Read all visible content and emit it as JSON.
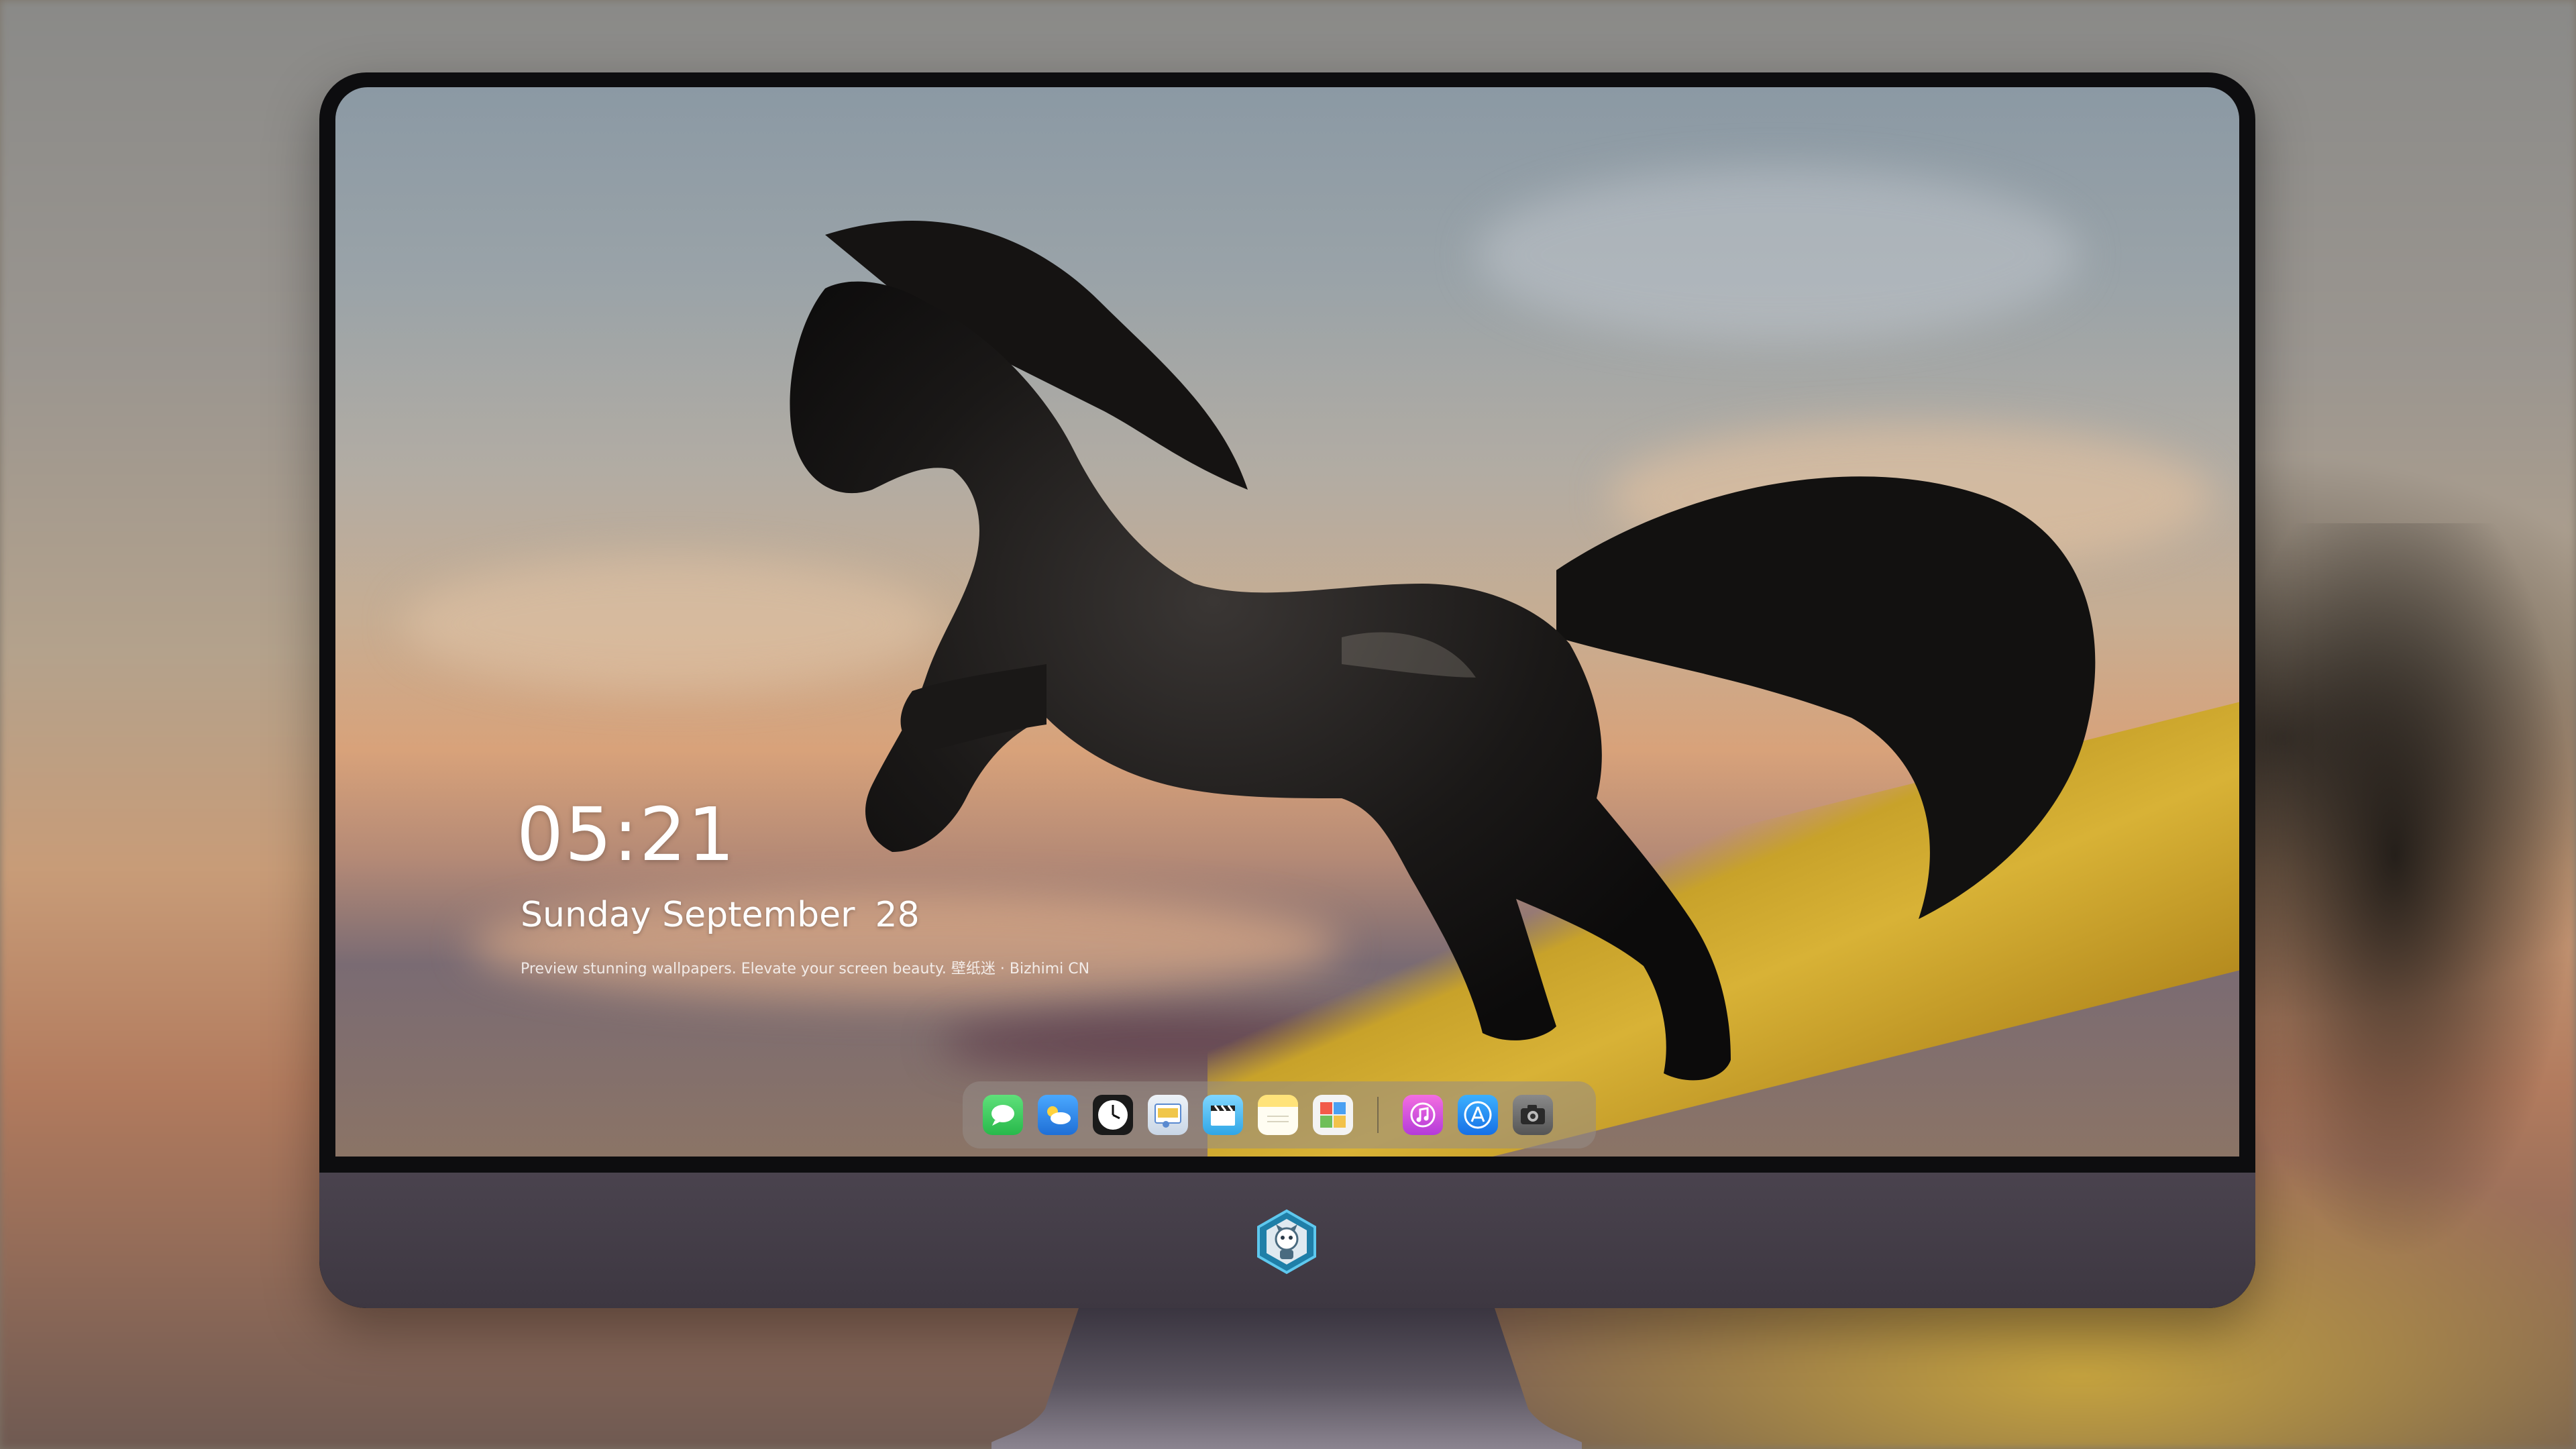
{
  "lockscreen": {
    "time": "05:21",
    "weekday_month": "Sunday September",
    "day": "28",
    "caption": "Preview stunning wallpapers. Elevate your screen beauty. 壁纸迷 · Bizhimi CN"
  },
  "dock": {
    "apps": [
      {
        "name": "messages-icon",
        "color": "#34c759"
      },
      {
        "name": "weather-icon",
        "color": "#2f8ff0"
      },
      {
        "name": "clock-icon",
        "color": "#1a1a1a"
      },
      {
        "name": "preview-icon",
        "color": "#f0c64a"
      },
      {
        "name": "clips-icon",
        "color": "#4fc3f7"
      },
      {
        "name": "notes-icon",
        "color": "#ffd84a"
      },
      {
        "name": "photo-gallery-icon",
        "color": "#6fbf5a"
      },
      {
        "name": "music-icon",
        "color": "#e64fd8"
      },
      {
        "name": "app-store-icon",
        "color": "#1e88f5"
      },
      {
        "name": "camera-icon",
        "color": "#6b6b6b"
      }
    ]
  },
  "colors": {
    "monitor_bezel": "#0d0d0f",
    "monitor_chin": "#4a434e",
    "text": "#ffffff"
  }
}
